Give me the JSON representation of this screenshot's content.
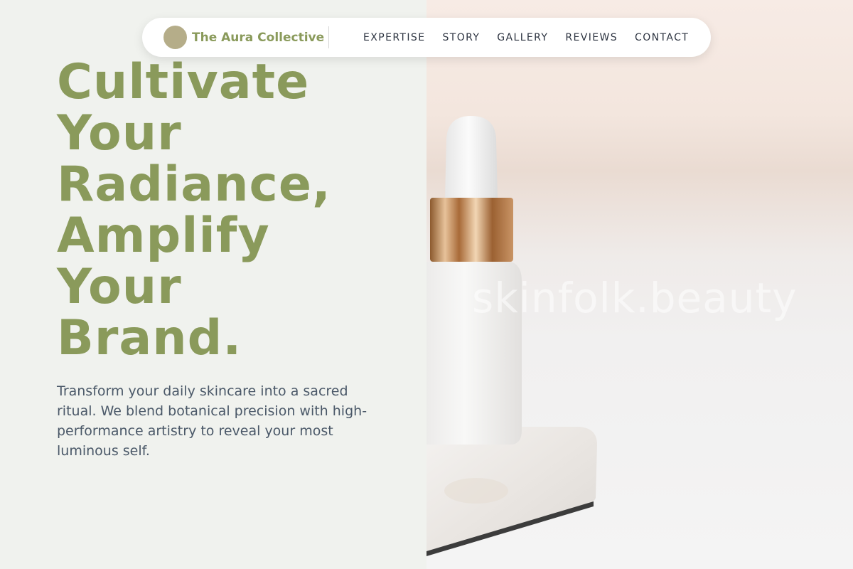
{
  "nav": {
    "brand": "The Aura Collective",
    "links": [
      "EXPERTISE",
      "STORY",
      "GALLERY",
      "REVIEWS",
      "CONTACT"
    ]
  },
  "hero": {
    "title_lines": [
      "Cultivate",
      "Your",
      "Radiance,",
      "Amplify",
      "Your",
      "Brand."
    ],
    "description": "Transform your daily skincare into a sacred ritual. We blend botanical precision with high-performance artistry to reveal your most luminous self."
  },
  "image": {
    "subject": "serum-dropper-bottle-on-marble-block",
    "watermark": "skinfolk.beauty"
  },
  "colors": {
    "accent": "#8a9a5b",
    "brand_dot": "#b5ad89",
    "text_muted": "#4a5868",
    "background": "#f0f2ee"
  }
}
